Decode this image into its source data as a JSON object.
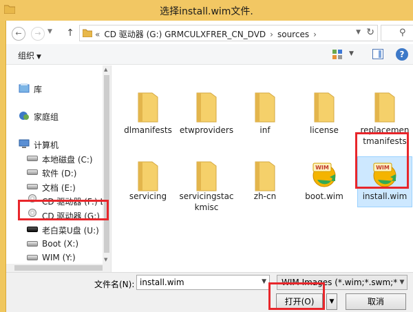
{
  "window": {
    "title": "选择install.wim文件."
  },
  "address": {
    "segments": [
      "«",
      "CD 驱动器 (G:) GRMCULXFRER_CN_DVD",
      "›",
      "sources",
      "›"
    ]
  },
  "toolbar": {
    "organize": "组织",
    "help": "?"
  },
  "sidebar": {
    "items": [
      {
        "label": "库",
        "icon": "library-icon"
      },
      {
        "label": "家庭组",
        "icon": "homegroup-icon"
      },
      {
        "label": "计算机",
        "icon": "computer-icon"
      },
      {
        "label": "本地磁盘 (C:)",
        "icon": "drive-icon"
      },
      {
        "label": "软件 (D:)",
        "icon": "drive-icon"
      },
      {
        "label": "文档 (E:)",
        "icon": "drive-icon"
      },
      {
        "label": "CD 驱动器 (F:) L",
        "icon": "cd-drive-icon"
      },
      {
        "label": "CD 驱动器 (G:) C",
        "icon": "cd-drive-icon"
      },
      {
        "label": "老白菜U盘 (U:)",
        "icon": "usb-drive-icon"
      },
      {
        "label": "Boot (X:)",
        "icon": "drive-icon"
      },
      {
        "label": "WIM (Y:)",
        "icon": "drive-icon"
      }
    ]
  },
  "files": [
    {
      "name": "dlmanifests",
      "type": "folder"
    },
    {
      "name": "etwproviders",
      "type": "folder"
    },
    {
      "name": "inf",
      "type": "folder"
    },
    {
      "name": "license",
      "type": "folder"
    },
    {
      "name": "replacementmanifests",
      "type": "folder"
    },
    {
      "name": "servicing",
      "type": "folder"
    },
    {
      "name": "servicingstackmisc",
      "type": "folder"
    },
    {
      "name": "zh-cn",
      "type": "folder"
    },
    {
      "name": "boot.wim",
      "type": "wim",
      "badge": "WIM"
    },
    {
      "name": "install.wim",
      "type": "wim",
      "badge": "WIM"
    }
  ],
  "bottom": {
    "filename_label": "文件名(N):",
    "filename_value": "install.wim",
    "filetype_value": "WIM Images (*.wim;*.swm;*.e",
    "open_label": "打开(O)",
    "cancel_label": "取消"
  },
  "colors": {
    "titlebar": "#f2c763",
    "highlight": "#e8262b",
    "folder": "#f5d06a"
  }
}
